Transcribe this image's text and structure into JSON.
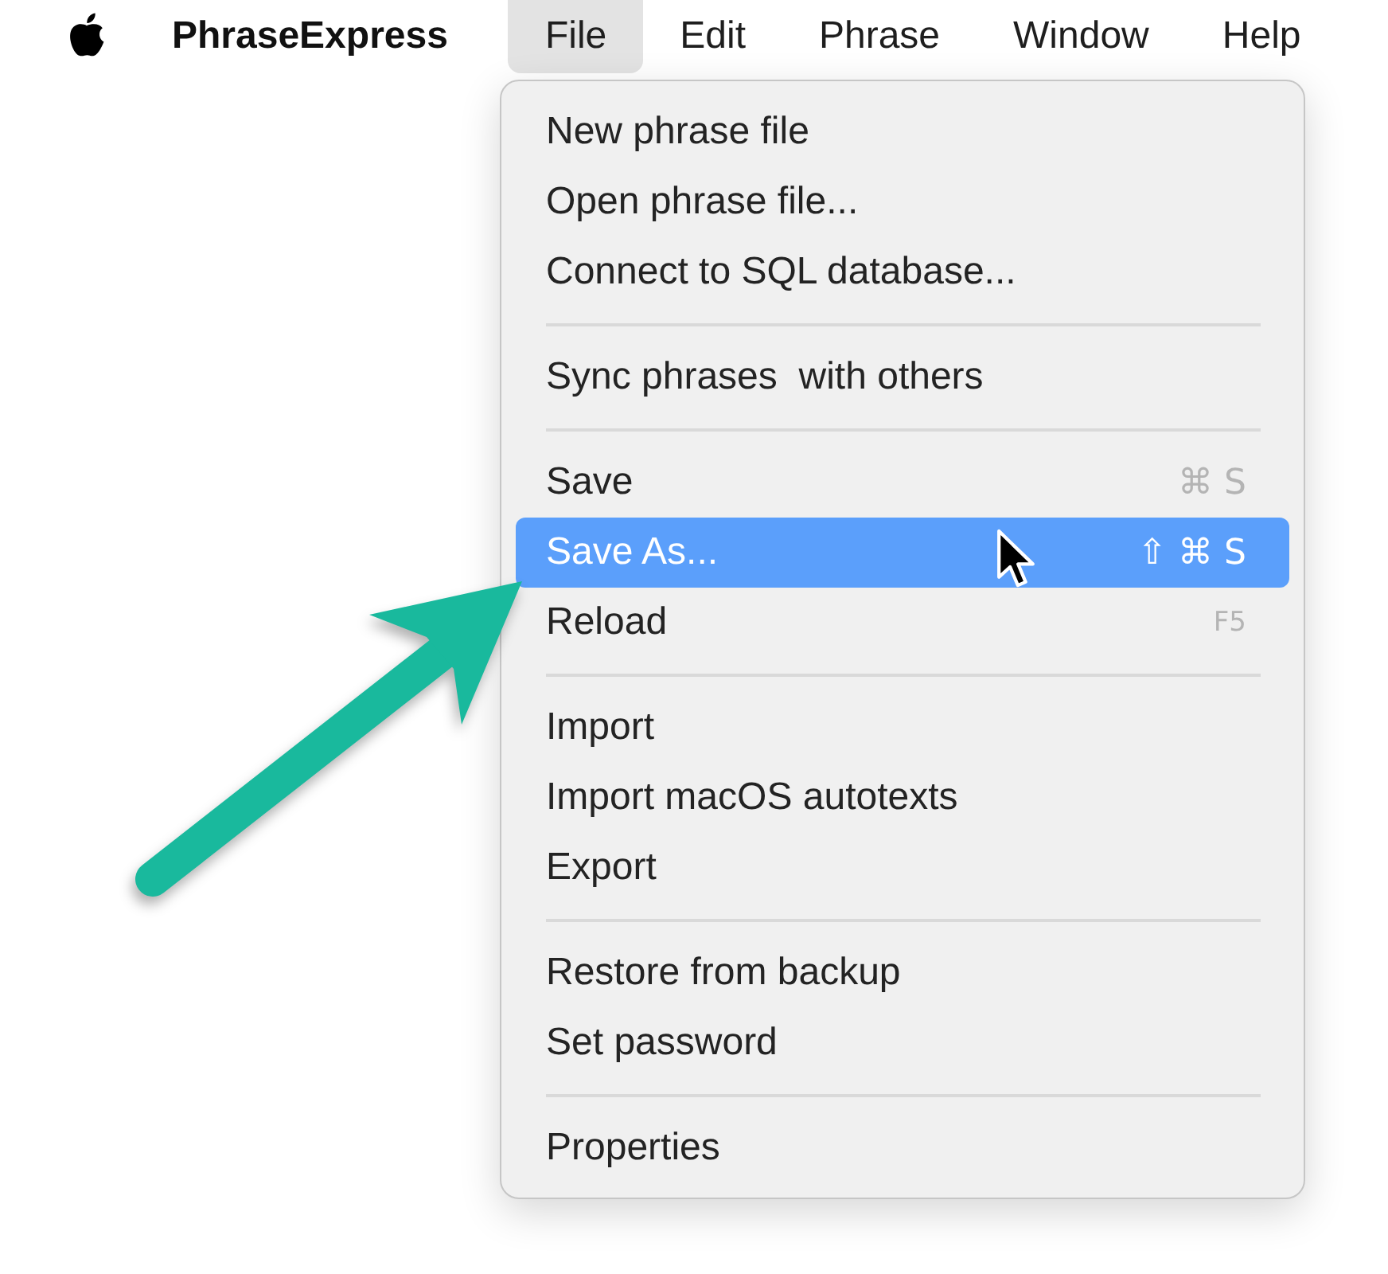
{
  "menu_bar": {
    "app_name": "PhraseExpress",
    "menus": [
      {
        "label": "File",
        "selected": true
      },
      {
        "label": "Edit",
        "selected": false
      },
      {
        "label": "Phrase",
        "selected": false
      },
      {
        "label": "Window",
        "selected": false
      },
      {
        "label": "Help",
        "selected": false
      }
    ]
  },
  "file_menu": {
    "groups": [
      {
        "items": [
          {
            "label": "New phrase file",
            "selected": false
          },
          {
            "label": "Open phrase file...",
            "selected": false
          },
          {
            "label": "Connect to SQL database...",
            "selected": false
          }
        ]
      },
      {
        "items": [
          {
            "label": "Sync phrases  with others",
            "selected": false
          }
        ]
      },
      {
        "items": [
          {
            "label": "Save",
            "shortcut": "⌘ S",
            "selected": false
          },
          {
            "label": "Save As...",
            "shortcut": "⇧ ⌘ S",
            "selected": true
          },
          {
            "label": "Reload",
            "shortcut": "F5",
            "selected": false
          }
        ]
      },
      {
        "items": [
          {
            "label": "Import",
            "selected": false
          },
          {
            "label": "Import macOS autotexts",
            "selected": false
          },
          {
            "label": "Export",
            "selected": false
          }
        ]
      },
      {
        "items": [
          {
            "label": "Restore from backup",
            "selected": false
          },
          {
            "label": "Set password",
            "selected": false
          }
        ]
      },
      {
        "items": [
          {
            "label": "Properties",
            "selected": false
          }
        ]
      }
    ]
  }
}
